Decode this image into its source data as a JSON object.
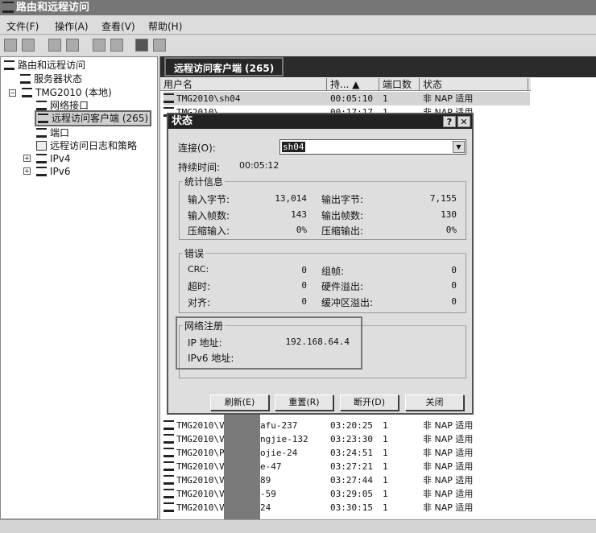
{
  "window": {
    "title": "路由和远程访问"
  },
  "menu": [
    "文件(F)",
    "操作(A)",
    "查看(V)",
    "帮助(H)"
  ],
  "toolbar": [
    "back-icon",
    "forward-icon",
    "up-icon",
    "show-hide-tree-icon",
    "refresh-icon",
    "export-icon",
    "help-icon",
    "show-hide-action-icon"
  ],
  "tree": {
    "root": "路由和远程访问",
    "server_status": "服务器状态",
    "server": "TMG2010 (本地)",
    "network_interfaces": "网络接口",
    "remote_clients": "远程访问客户端 (265)",
    "ports": "端口",
    "logging": "远程访问日志和策略",
    "ipv4": "IPv4",
    "ipv6": "IPv6"
  },
  "pane": {
    "title": "远程访问客户端 (265)",
    "columns": [
      "用户名",
      "持... ▲",
      "端口数",
      "状态"
    ],
    "rows_top": [
      [
        "TMG2010\\sh04",
        "00:05:10",
        "1",
        "非 NAP 适用"
      ],
      [
        "TMG2010\\...",
        "00:17:17",
        "1",
        "非 NAP 适用"
      ]
    ],
    "rows_bottom": [
      [
        "TMG2010\\V",
        "afu-237",
        "03:20:25",
        "1",
        "非 NAP 适用"
      ],
      [
        "TMG2010\\V",
        "ngjie-132",
        "03:23:30",
        "1",
        "非 NAP 适用"
      ],
      [
        "TMG2010\\P",
        "ojie-24",
        "03:24:51",
        "1",
        "非 NAP 适用"
      ],
      [
        "TMG2010\\V",
        "e-47",
        "03:27:21",
        "1",
        "非 NAP 适用"
      ],
      [
        "TMG2010\\V",
        "89",
        "03:27:44",
        "1",
        "非 NAP 适用"
      ],
      [
        "TMG2010\\V",
        "-59",
        "03:29:05",
        "1",
        "非 NAP 适用"
      ],
      [
        "TMG2010\\V",
        "24",
        "03:30:15",
        "1",
        "非 NAP 适用"
      ]
    ]
  },
  "dialog": {
    "title": "状态",
    "help": "?",
    "close": "✕",
    "connection_label": "连接(O):",
    "connection_value": "sh04",
    "duration_label": "持续时间:",
    "duration_value": "00:05:12",
    "stats": {
      "title": "统计信息",
      "bytes_in_label": "输入字节:",
      "bytes_in": "13,014",
      "bytes_out_label": "输出字节:",
      "bytes_out": "7,155",
      "frames_in_label": "输入帧数:",
      "frames_in": "143",
      "frames_out_label": "输出帧数:",
      "frames_out": "130",
      "comp_in_label": "压缩输入:",
      "comp_in": "0%",
      "comp_out_label": "压缩输出:",
      "comp_out": "0%"
    },
    "errors": {
      "title": "错误",
      "crc_label": "CRC:",
      "crc": "0",
      "framing_label": "组帧:",
      "framing": "0",
      "timeout_label": "超时:",
      "timeout": "0",
      "hw_overrun_label": "硬件溢出:",
      "hw_overrun": "0",
      "align_label": "对齐:",
      "align": "0",
      "buf_overrun_label": "缓冲区溢出:",
      "buf_overrun": "0"
    },
    "network": {
      "title": "网络注册",
      "ip_label": "IP 地址:",
      "ip": "192.168.64.4",
      "ipv6_label": "IPv6 地址:"
    },
    "buttons": [
      "刷新(E)",
      "重置(R)",
      "断开(D)",
      "关闭"
    ]
  }
}
